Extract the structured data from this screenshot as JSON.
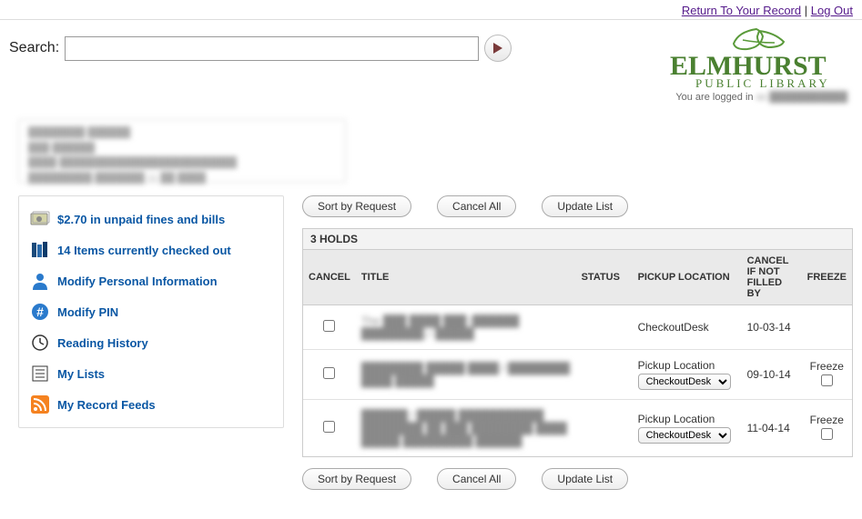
{
  "top": {
    "return_link": "Return To Your Record",
    "separator": " | ",
    "logout_link": "Log Out"
  },
  "search": {
    "label": "Search:",
    "value": ""
  },
  "brand": {
    "name": "ELMHURST",
    "subtitle": "PUBLIC LIBRARY",
    "logged_in_prefix": "You are logged in ",
    "logged_in_user": "as ███████████"
  },
  "user_box_lines": [
    "████████ ██████",
    "███ ██████",
    "████ █████████████████████████",
    "█████████ ███████ 11 ██ ████"
  ],
  "sidebar": {
    "items": [
      {
        "label": "$2.70 in unpaid fines and bills",
        "icon": "money-icon"
      },
      {
        "label": "14 Items currently checked out",
        "icon": "books-icon"
      },
      {
        "label": "Modify Personal Information",
        "icon": "person-icon"
      },
      {
        "label": "Modify PIN",
        "icon": "hash-icon"
      },
      {
        "label": "Reading History",
        "icon": "clock-icon"
      },
      {
        "label": "My Lists",
        "icon": "list-icon"
      },
      {
        "label": "My Record Feeds",
        "icon": "rss-icon"
      }
    ]
  },
  "buttons": {
    "sort": "Sort by Request",
    "cancel_all": "Cancel All",
    "update": "Update List"
  },
  "holds": {
    "heading": "3 HOLDS",
    "columns": {
      "cancel": "CANCEL",
      "title": "TITLE",
      "status": "STATUS",
      "pickup": "PICKUP LOCATION",
      "cancel_by": "CANCEL IF NOT FILLED BY",
      "freeze": "FREEZE"
    },
    "pickup_label": "Pickup Location",
    "pickup_option": "CheckoutDesk",
    "freeze_label": "Freeze",
    "rows": [
      {
        "title": "The ███ ████ ███ [██████ ████████] / █████",
        "pickup_static": "CheckoutDesk",
        "date": "10-03-14",
        "has_select": false,
        "has_freeze": false
      },
      {
        "title": "████████ █████ ████ / ████████ ████ █████",
        "date": "09-10-14",
        "has_select": true,
        "has_freeze": true
      },
      {
        "title": "██████ / █████ ███████████ ████████ ██ ███ ████████ ████ █████ █████████ ██████",
        "date": "11-04-14",
        "has_select": true,
        "has_freeze": true
      }
    ]
  }
}
